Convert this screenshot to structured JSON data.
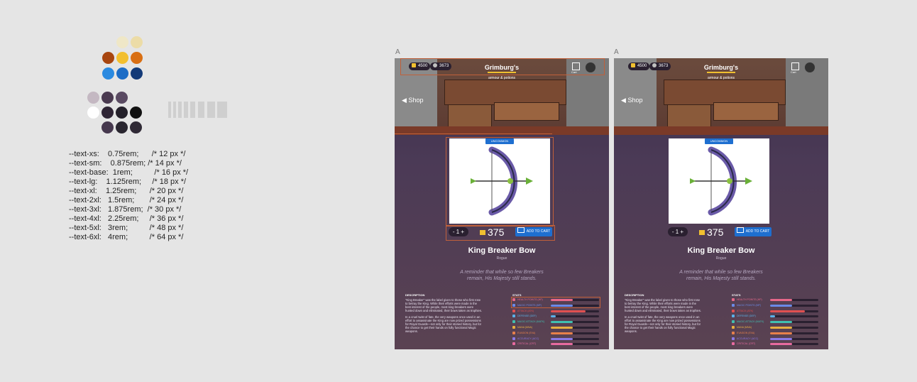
{
  "tokens": [
    "--text-xs:    0.75rem;      /* 12 px */",
    "--text-sm:    0.875rem; /* 14 px */",
    "--text-base:  1rem;          /* 16 px */",
    "--text-lg:    1.125rem;     /* 18 px */",
    "--text-xl:    1.25rem;      /* 20 px */",
    "--text-2xl:   1.5rem;       /* 24 px */",
    "--text-3xl:   1.875rem;  /* 30 px */",
    "--text-4xl:   2.25rem;     /* 36 px */",
    "--text-5xl:   3rem;          /* 48 px */",
    "--text-6xl:   4rem;          /* 64 px */"
  ],
  "colors": {
    "cream1": "#efe7c7",
    "cream2": "#ecdca7",
    "rust": "#a8460f",
    "gold": "#f2bf2f",
    "orange": "#d96f13",
    "blue1": "#2b8ae0",
    "blue2": "#1d6dc6",
    "navy": "#133a78",
    "mauve1": "#c4b8c2",
    "plum1": "#4a3a50",
    "plum2": "#5a4a62",
    "white": "#ffffff",
    "dark1": "#2e2434",
    "dark2": "#24202a",
    "black": "#111111",
    "plum3": "#46384e",
    "dark3": "#2a2630",
    "dark4": "#302a36"
  },
  "frames": [
    {
      "label": "A"
    },
    {
      "label": "A"
    }
  ],
  "shop": {
    "coins": "4500",
    "gems": "3673",
    "brand": "Grimburg's",
    "brand_sub": "armour & potions",
    "cart_label": "Cart",
    "back_label": "Shop",
    "badge": "UNCOMMON",
    "qty": "- 1 +",
    "price": "375",
    "add_to_cart": "ADD TO CART",
    "item_name": "King Breaker Bow",
    "item_class": "Rogue",
    "quote": "A reminder that while so few Breakers remain, His Majesty still stands.",
    "description_heading": "DESCRIPTION",
    "description_p1": "\"King Breaker\" was the label given to those who first rose to betray the King. While their efforts were made in the best interest of the people, most king breakers were hunted down and eliminated, their bows taken as trophies.",
    "description_p2": "In a cruel twist of fate, the very weapons once used in an effort to assassinate the King are now prized possessions for Royal Guards—not only for their storied history, but for the chance to get their hands on fully functional Magic weapons.",
    "stats_heading": "STATS",
    "stats": [
      {
        "label": "HEALTH POINTS (HP)",
        "color": "#e8688a",
        "value": 0.45
      },
      {
        "label": "MAGIC POINTS (MP)",
        "color": "#6a8ae8",
        "value": 0.45
      },
      {
        "label": "ATTACK (ATK)",
        "color": "#e05050",
        "value": 0.72
      },
      {
        "label": "DEFENSE (DEF)",
        "color": "#5ab0e8",
        "value": 0.1
      },
      {
        "label": "MAGIC ATTACK (MATK)",
        "color": "#40c0b0",
        "value": 0.45
      },
      {
        "label": "MANA (MNA)",
        "color": "#e8b040",
        "value": 0.45
      },
      {
        "label": "EVASION (EVA)",
        "color": "#e8804a",
        "value": 0.45
      },
      {
        "label": "ACCURACY (ACC)",
        "color": "#8a7ae8",
        "value": 0.45
      },
      {
        "label": "CRITICAL (CRT)",
        "color": "#e86aa0",
        "value": 0.45
      }
    ]
  }
}
